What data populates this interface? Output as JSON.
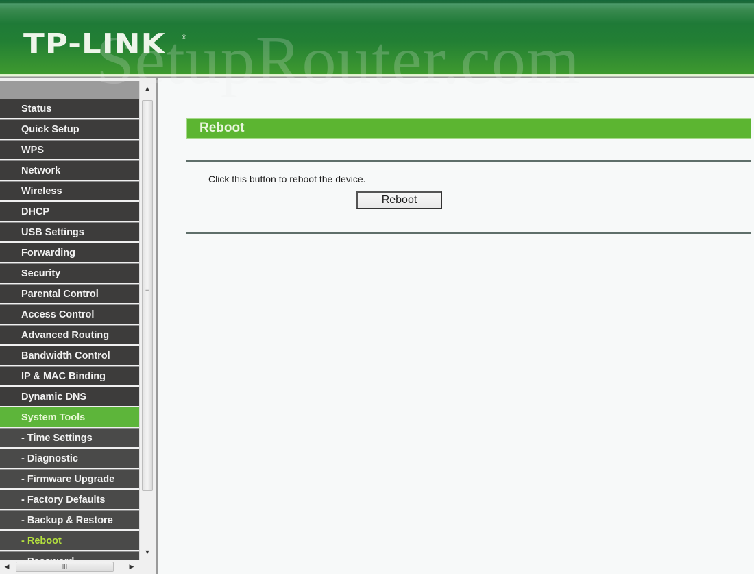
{
  "header": {
    "brand": "TP-LINK",
    "registered_mark": "®",
    "watermark": "SetupRouter.com"
  },
  "sidebar": {
    "items": [
      {
        "label": "Status",
        "type": "top"
      },
      {
        "label": "Quick Setup",
        "type": "top"
      },
      {
        "label": "WPS",
        "type": "top"
      },
      {
        "label": "Network",
        "type": "top"
      },
      {
        "label": "Wireless",
        "type": "top"
      },
      {
        "label": "DHCP",
        "type": "top"
      },
      {
        "label": "USB Settings",
        "type": "top"
      },
      {
        "label": "Forwarding",
        "type": "top"
      },
      {
        "label": "Security",
        "type": "top"
      },
      {
        "label": "Parental Control",
        "type": "top"
      },
      {
        "label": "Access Control",
        "type": "top"
      },
      {
        "label": "Advanced Routing",
        "type": "top"
      },
      {
        "label": "Bandwidth Control",
        "type": "top"
      },
      {
        "label": "IP & MAC Binding",
        "type": "top"
      },
      {
        "label": "Dynamic DNS",
        "type": "top"
      },
      {
        "label": "System Tools",
        "type": "active-parent"
      },
      {
        "label": "- Time Settings",
        "type": "sub"
      },
      {
        "label": "- Diagnostic",
        "type": "sub"
      },
      {
        "label": "- Firmware Upgrade",
        "type": "sub"
      },
      {
        "label": "- Factory Defaults",
        "type": "sub"
      },
      {
        "label": "- Backup & Restore",
        "type": "sub"
      },
      {
        "label": "- Reboot",
        "type": "current"
      },
      {
        "label": "- Password",
        "type": "sub"
      }
    ],
    "scroll_up_icon": "▲",
    "scroll_down_icon": "▼",
    "scroll_left_icon": "◀",
    "scroll_right_icon": "▶",
    "vgrip": "≡",
    "hgrip": "III"
  },
  "main": {
    "section_title": "Reboot",
    "description": "Click this button to reboot the device.",
    "reboot_button_label": "Reboot"
  },
  "colors": {
    "header_green": "#227f34",
    "accent_green": "#5cb531",
    "menu_dark": "#3d3c3b",
    "current_item_text": "#b5e23e"
  }
}
